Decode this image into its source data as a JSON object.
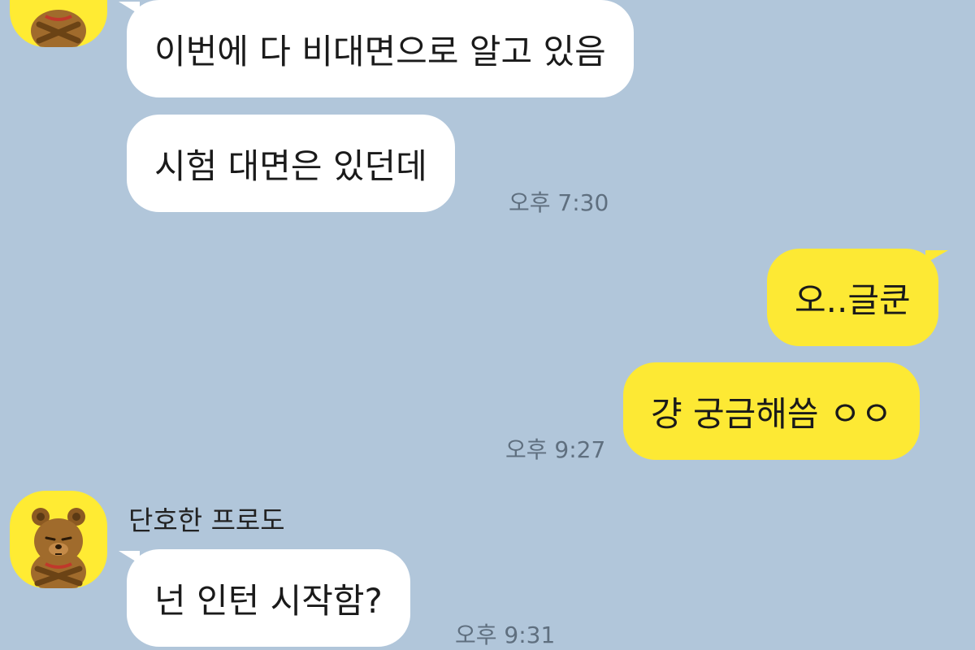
{
  "chat": {
    "messages": [
      {
        "direction": "in",
        "text": "이번에 다 비대면으로 알고 있음"
      },
      {
        "direction": "in",
        "text": "시험 대면은 있던데",
        "time": "오후 7:30"
      },
      {
        "direction": "out",
        "text": "오..글쿤"
      },
      {
        "direction": "out",
        "text": "걍 궁금해씀 ㅇㅇ",
        "time": "오후 9:27"
      },
      {
        "direction": "in",
        "sender": "단호한 프로도",
        "text": "넌 인턴 시작함?",
        "time": "오후 9:31"
      }
    ]
  },
  "icons": {
    "avatar": "frodo-bear-icon"
  },
  "colors": {
    "background": "#b1c6da",
    "incoming_bubble": "#ffffff",
    "outgoing_bubble": "#fde934",
    "avatar_bg": "#ffeb33"
  }
}
